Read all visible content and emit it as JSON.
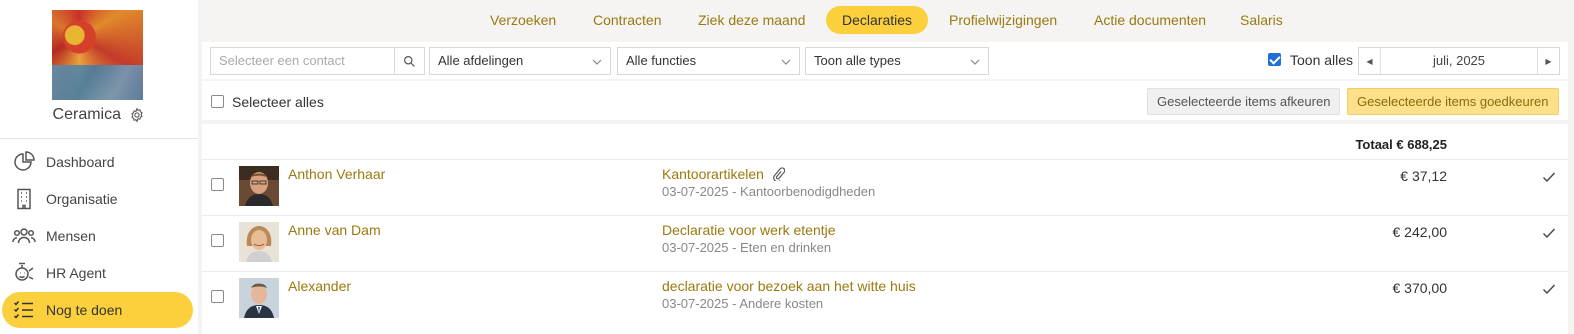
{
  "sidebar": {
    "company": "Ceramica",
    "items": [
      {
        "label": "Dashboard",
        "icon": "pie-chart-icon"
      },
      {
        "label": "Organisatie",
        "icon": "building-icon"
      },
      {
        "label": "Mensen",
        "icon": "people-icon"
      },
      {
        "label": "HR Agent",
        "icon": "agent-icon"
      },
      {
        "label": "Nog te doen",
        "icon": "checklist-icon",
        "active": true
      }
    ]
  },
  "tabs": [
    {
      "label": "Verzoeken"
    },
    {
      "label": "Contracten"
    },
    {
      "label": "Ziek deze maand"
    },
    {
      "label": "Declaraties",
      "active": true
    },
    {
      "label": "Profielwijzigingen"
    },
    {
      "label": "Actie documenten"
    },
    {
      "label": "Salaris"
    }
  ],
  "filters": {
    "contact_placeholder": "Selecteer een contact",
    "department": "Alle afdelingen",
    "function": "Alle functies",
    "type": "Toon alle types",
    "show_all_label": "Toon alles",
    "show_all_checked": true,
    "month": "juli, 2025"
  },
  "actions": {
    "select_all_label": "Selecteer alles",
    "reject_label": "Geselecteerde items afkeuren",
    "approve_label": "Geselecteerde items goedkeuren"
  },
  "list": {
    "total": "Totaal € 688,25",
    "rows": [
      {
        "name": "Anthon Verhaar",
        "title": "Kantoorartikelen",
        "attachment": true,
        "sub": "03-07-2025 - Kantoorbenodigdheden",
        "amount": "€ 37,12"
      },
      {
        "name": "Anne van Dam",
        "title": "Declaratie voor werk etentje",
        "attachment": false,
        "sub": "03-07-2025 - Eten en drinken",
        "amount": "€ 242,00"
      },
      {
        "name": "Alexander",
        "title": "declaratie voor bezoek aan het witte huis",
        "attachment": false,
        "sub": "03-07-2025 - Andere kosten",
        "amount": "€ 370,00"
      }
    ]
  },
  "colors": {
    "accent": "#fcd03c",
    "link": "#9a7a10"
  }
}
